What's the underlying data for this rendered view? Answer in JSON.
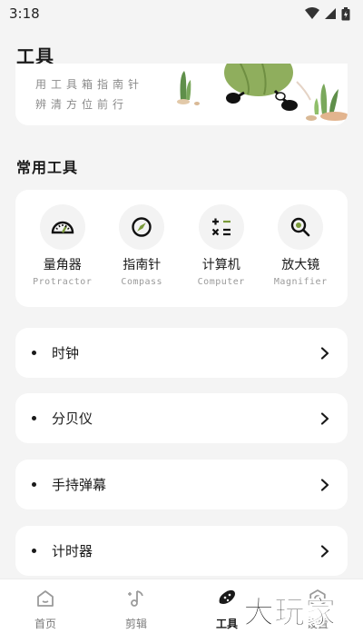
{
  "status_bar": {
    "time": "3:18"
  },
  "page": {
    "title": "工具"
  },
  "banner": {
    "line1": "用工具箱指南针",
    "line2": "辨清方位前行"
  },
  "section": {
    "common_tools_title": "常用工具"
  },
  "tools": [
    {
      "name": "量角器",
      "sub": "Protractor",
      "icon": "protractor-icon"
    },
    {
      "name": "指南针",
      "sub": "Compass",
      "icon": "compass-icon"
    },
    {
      "name": "计算机",
      "sub": "Computer",
      "icon": "calculator-icon"
    },
    {
      "name": "放大镜",
      "sub": "Magnifier",
      "icon": "magnifier-icon"
    }
  ],
  "list": [
    {
      "label": "时钟"
    },
    {
      "label": "分贝仪"
    },
    {
      "label": "手持弹幕"
    },
    {
      "label": "计时器"
    }
  ],
  "bottom_nav": [
    {
      "label": "首页",
      "icon": "home-icon",
      "active": false
    },
    {
      "label": "剪辑",
      "icon": "music-note-icon",
      "active": false
    },
    {
      "label": "工具",
      "icon": "pickle-icon",
      "active": true
    },
    {
      "label": "设置",
      "icon": "settings-icon",
      "active": false
    }
  ],
  "watermark": {
    "text": "大玩家"
  },
  "colors": {
    "accent_green": "#7a9a3a",
    "background": "#f4f4f4",
    "card": "#ffffff"
  }
}
